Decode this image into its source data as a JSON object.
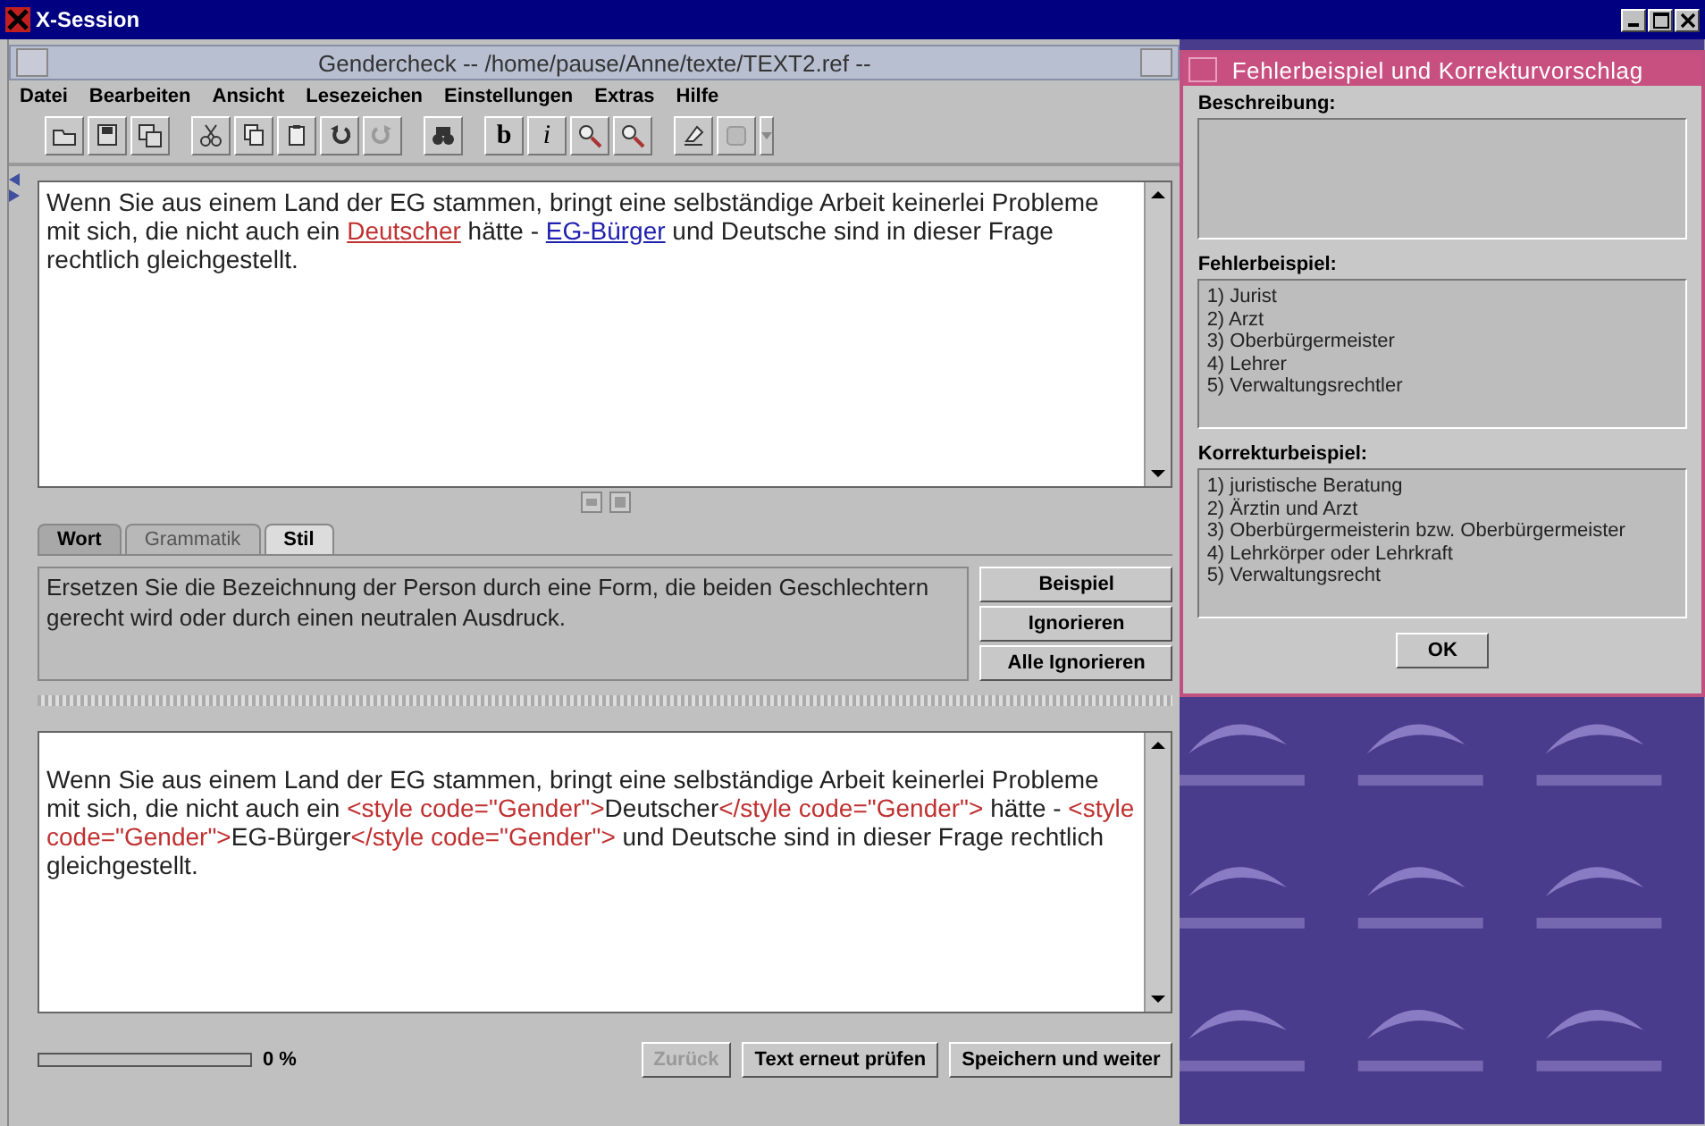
{
  "session_title": "X-Session",
  "main_window": {
    "title": "Gendercheck -- /home/pause/Anne/texte/TEXT2.ref --",
    "menu": [
      "Datei",
      "Bearbeiten",
      "Ansicht",
      "Lesezeichen",
      "Einstellungen",
      "Extras",
      "Hilfe"
    ],
    "toolbar": [
      {
        "kind": "open",
        "disabled": false
      },
      {
        "kind": "save",
        "disabled": false
      },
      {
        "kind": "save-all",
        "disabled": false
      },
      {
        "kind": "sep"
      },
      {
        "kind": "cut",
        "disabled": false
      },
      {
        "kind": "copy",
        "disabled": false
      },
      {
        "kind": "paste",
        "disabled": false
      },
      {
        "kind": "undo",
        "disabled": false
      },
      {
        "kind": "redo",
        "disabled": true
      },
      {
        "kind": "sep"
      },
      {
        "kind": "find",
        "disabled": false
      },
      {
        "kind": "sep"
      },
      {
        "kind": "bold",
        "label": "b",
        "disabled": false
      },
      {
        "kind": "italic",
        "label": "i",
        "disabled": false
      },
      {
        "kind": "zoom-in",
        "disabled": false
      },
      {
        "kind": "zoom-out",
        "disabled": false
      },
      {
        "kind": "sep"
      },
      {
        "kind": "clear",
        "disabled": false
      },
      {
        "kind": "plugin",
        "disabled": true
      },
      {
        "kind": "dropdown",
        "disabled": true
      }
    ],
    "editor": [
      {
        "kind": "plain",
        "text": "Wenn Sie aus einem Land der EG stammen, bringt eine selbständige Arbeit keinerlei Probleme mit sich, die nicht auch ein "
      },
      {
        "kind": "error",
        "text": "Deutscher"
      },
      {
        "kind": "plain",
        "text": " hätte - "
      },
      {
        "kind": "link",
        "text": "EG-Bürger"
      },
      {
        "kind": "plain",
        "text": " und Deutsche sind in dieser Frage rechtlich gleichgestellt."
      }
    ],
    "tabs": [
      {
        "label": "Wort",
        "selected": false,
        "disabled": false
      },
      {
        "label": "Grammatik",
        "selected": false,
        "disabled": true
      },
      {
        "label": "Stil",
        "selected": true,
        "disabled": false
      }
    ],
    "message": "Ersetzen Sie die Bezeichnung der Person durch eine Form, die beiden Geschlechtern gerecht wird oder durch einen neutralen Ausdruck.",
    "side_buttons": [
      "Beispiel",
      "Ignorieren",
      "Alle Ignorieren"
    ],
    "source": [
      {
        "kind": "plain",
        "text": "Wenn Sie aus einem Land der EG stammen, bringt eine selbständige Arbeit keinerlei Probleme mit sich, die nicht auch ein "
      },
      {
        "kind": "tag",
        "text": "<style code=\"Gender\">"
      },
      {
        "kind": "plain",
        "text": "Deutscher"
      },
      {
        "kind": "tag",
        "text": "</style code=\"Gender\">"
      },
      {
        "kind": "plain",
        "text": " hätte - "
      },
      {
        "kind": "tag",
        "text": "<style code=\"Gender\">"
      },
      {
        "kind": "plain",
        "text": "EG-Bürger"
      },
      {
        "kind": "tag",
        "text": "</style code=\"Gender\">"
      },
      {
        "kind": "plain",
        "text": " und Deutsche sind in dieser Frage rechtlich gleichgestellt."
      }
    ],
    "progress": {
      "level": 0,
      "reading": "0 %"
    },
    "bottom_buttons": [
      {
        "label": "Zurück",
        "disabled": true
      },
      {
        "label": "Text erneut prüfen",
        "disabled": false
      },
      {
        "label": "Speichern und weiter",
        "disabled": false
      }
    ]
  },
  "dialog": {
    "title": "Fehlerbeispiel und Korrekturvorschlag",
    "sections": [
      {
        "label": "Beschreibung:"
      },
      {
        "label": "Fehlerbeispiel:",
        "items": [
          "1) Jurist",
          "2) Arzt",
          "3) Oberbürgermeister",
          "4) Lehrer",
          "5) Verwaltungsrechtler"
        ]
      },
      {
        "label": "Korrekturbeispiel:",
        "items": [
          "1) juristische Beratung",
          "2) Ärztin und Arzt",
          "3) Oberbürgermeisterin bzw. Oberbürgermeister",
          "4) Lehrkörper oder Lehrkraft",
          "5) Verwaltungsrecht"
        ]
      }
    ],
    "ok": "OK"
  }
}
